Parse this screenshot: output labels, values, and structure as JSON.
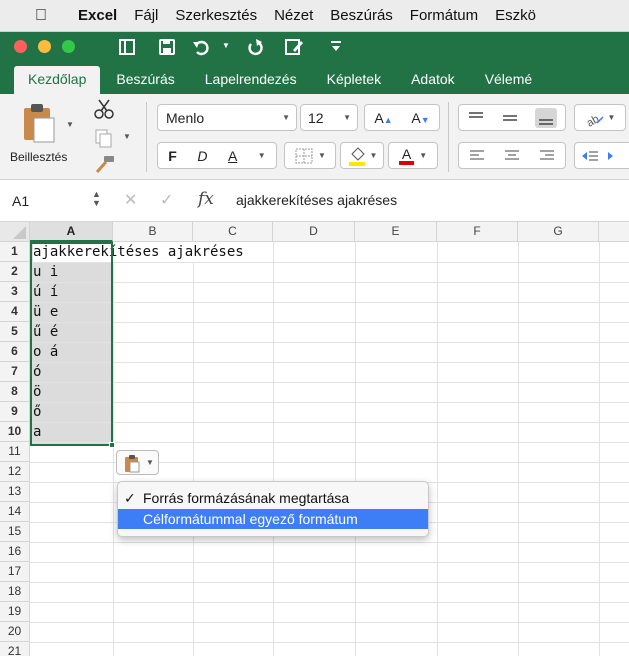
{
  "menubar": {
    "app": "Excel",
    "items": [
      "Fájl",
      "Szerkesztés",
      "Nézet",
      "Beszúrás",
      "Formátum",
      "Eszkö"
    ]
  },
  "ribbon_tabs": [
    "Kezdőlap",
    "Beszúrás",
    "Lapelrendezés",
    "Képletek",
    "Adatok",
    "Vélemé"
  ],
  "ribbon": {
    "paste_label": "Beillesztés",
    "font_name": "Menlo",
    "font_size": "12",
    "bold": "F",
    "italic": "D",
    "underline": "A",
    "font_color_label": "A",
    "grow_font": "A",
    "shrink_font": "A"
  },
  "formula_bar": {
    "name_box": "A1",
    "fx": "fx",
    "content": "ajakkerekítéses ajakréses"
  },
  "columns": [
    "A",
    "B",
    "C",
    "D",
    "E",
    "F",
    "G"
  ],
  "rows": [
    "1",
    "2",
    "3",
    "4",
    "5",
    "6",
    "7",
    "8",
    "9",
    "10",
    "11",
    "12",
    "13",
    "14",
    "15",
    "16",
    "17",
    "18",
    "19",
    "20",
    "21"
  ],
  "cells": [
    "ajakkerekítéses ajakréses",
    "u i",
    "ú í",
    "ü e",
    "ű é",
    "o á",
    "ó",
    "ö",
    "ő",
    "a"
  ],
  "paste_menu": {
    "items": [
      {
        "check": "✓",
        "label": "Forrás formázásának megtartása"
      },
      {
        "check": "",
        "label": "Célformátummal egyező formátum"
      }
    ]
  },
  "colors": {
    "excel_green": "#217346",
    "highlight_blue": "#3d7df6"
  }
}
